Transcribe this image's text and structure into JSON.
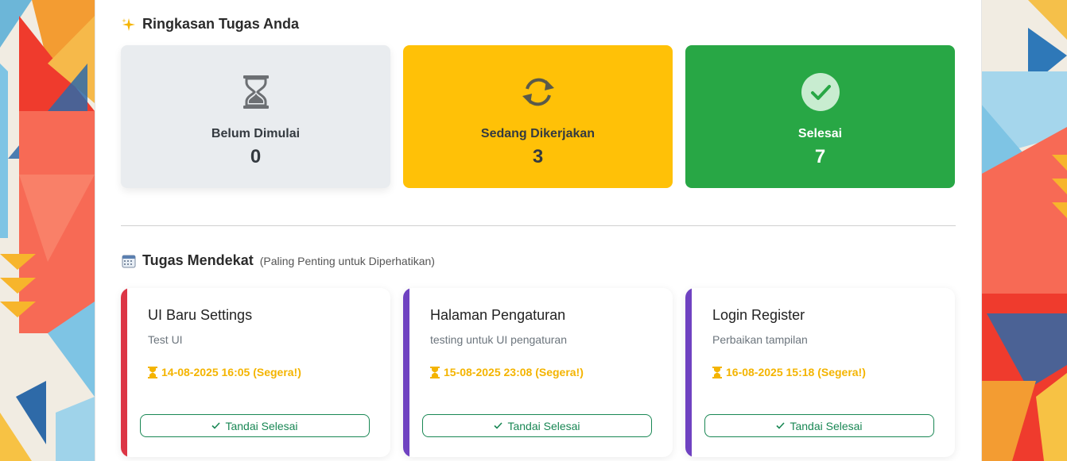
{
  "summary": {
    "title": "Ringkasan Tugas Anda",
    "icon": "sparkles-icon",
    "cards": [
      {
        "label": "Belum Dimulai",
        "count": "0",
        "icon": "hourglass-icon",
        "color": "#e9ecef"
      },
      {
        "label": "Sedang Dikerjakan",
        "count": "3",
        "icon": "sync-icon",
        "color": "#ffc107"
      },
      {
        "label": "Selesai",
        "count": "7",
        "icon": "check-circle-icon",
        "color": "#28a745"
      }
    ]
  },
  "upcoming": {
    "title": "Tugas Mendekat",
    "subtitle": "(Paling Penting untuk Diperhatikan)",
    "icon": "calendar-icon",
    "tasks": [
      {
        "title": "UI Baru Settings",
        "desc": "Test UI",
        "deadline": "14-08-2025 16:05 (Segera!)",
        "button": "Tandai Selesai",
        "stripe": "#dc3545"
      },
      {
        "title": "Halaman Pengaturan",
        "desc": "testing untuk UI pengaturan",
        "deadline": "15-08-2025 23:08 (Segera!)",
        "button": "Tandai Selesai",
        "stripe": "#6f42c1"
      },
      {
        "title": "Login Register",
        "desc": "Perbaikan tampilan",
        "deadline": "16-08-2025 15:18 (Segera!)",
        "button": "Tandai Selesai",
        "stripe": "#6f42c1"
      }
    ]
  },
  "colors": {
    "accent_green": "#198754",
    "deadline": "#f4b400"
  }
}
